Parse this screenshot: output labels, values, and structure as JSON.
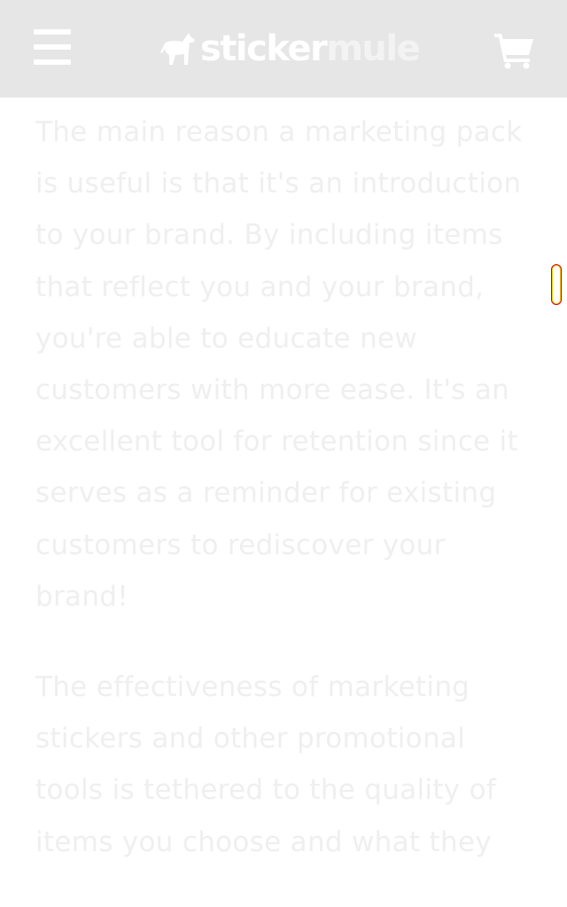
{
  "header": {
    "background": "#e6e6e6",
    "menu_icon": "hamburger-menu-icon",
    "logo_part1": "sticker",
    "logo_part2": "mule",
    "logo_icon": "mule-icon",
    "cart_icon": "shopping-cart-icon"
  },
  "article": {
    "paragraphs": [
      "The main reason a marketing pack is useful is that it's an introduction to your brand. By including items that reflect you and your brand, you're able to educate new customers with more ease. It's an excellent tool for retention since it serves as a reminder for existing customers to rediscover your brand!",
      "The effectiveness of marketing stickers and other promotional tools is tethered to the quality of items you choose and what they"
    ]
  },
  "colors": {
    "text": "#efefef",
    "scrollbar_border": "#d10000",
    "scrollbar_glow": "#f2d200"
  }
}
